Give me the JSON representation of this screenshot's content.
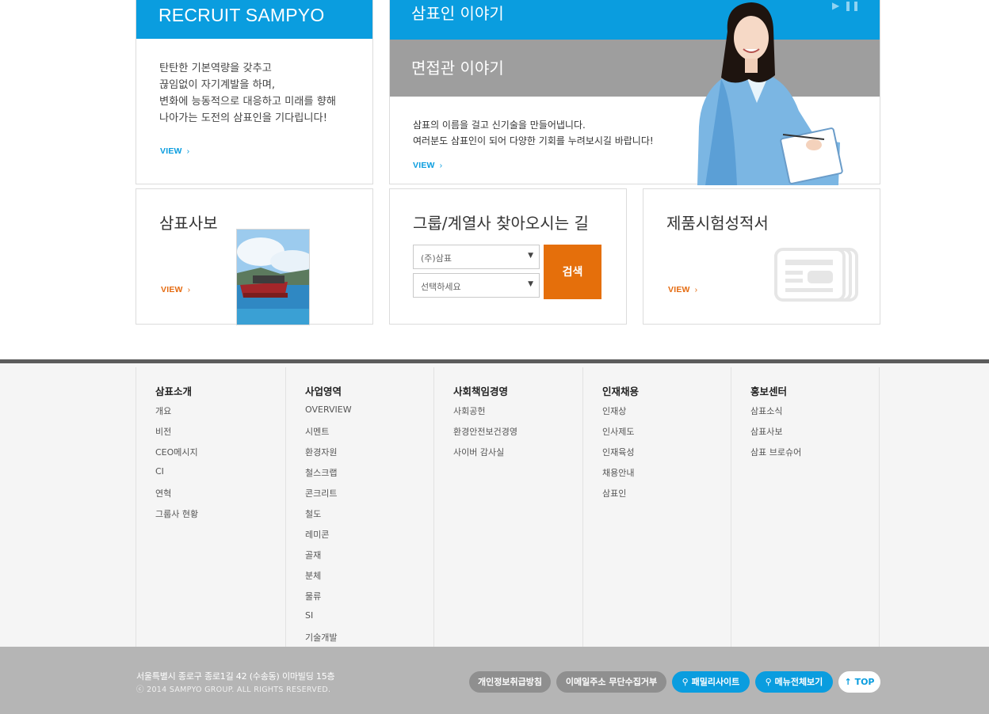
{
  "recruit": {
    "title": "RECRUIT SAMPYO",
    "lines": [
      "탄탄한 기본역량을 갖추고",
      "끊임없이 자기계발을 하며,",
      "변화에 능동적으로 대응하고 미래를 향해",
      "나아가는 도전의 삼표인을 기다립니다!"
    ],
    "view": "VIEW"
  },
  "story": {
    "title": "삼표인 이야기",
    "interview_title": "면접관 이야기",
    "lines": [
      "삼표의 이름을 걸고 신기술을 만들어냅니다.",
      "여러분도 삼표인이 되어 다양한 기회를 누려보시길 바랍니다!"
    ],
    "view": "VIEW",
    "play_icon": "play-icon",
    "pause_icon": "pause-icon"
  },
  "news": {
    "title": "삼표사보",
    "view": "VIEW"
  },
  "route": {
    "title": "그룹/계열사 찾아오시는 길",
    "company_select": "(주)삼표",
    "branch_select": "선택하세요",
    "search_label": "검색"
  },
  "cert": {
    "title": "제품시험성적서",
    "view": "VIEW",
    "icon": "document-icon"
  },
  "sitemap": [
    {
      "head": "삼표소개",
      "items": [
        "개요",
        "비전",
        "CEO메시지",
        "CI",
        "연혁",
        "그룹사 현황"
      ]
    },
    {
      "head": "사업영역",
      "items": [
        "OVERVIEW",
        "시멘트",
        "환경자원",
        "철스크랩",
        "콘크리트",
        "철도",
        "레미콘",
        "골재",
        "분체",
        "물류",
        "SI",
        "기술개발"
      ]
    },
    {
      "head": "사회책임경영",
      "items": [
        "사회공헌",
        "환경안전보건경영",
        "사이버 감사실"
      ]
    },
    {
      "head": "인재채용",
      "items": [
        "인재상",
        "인사제도",
        "인재육성",
        "채용안내",
        "삼표인"
      ]
    },
    {
      "head": "홍보센터",
      "items": [
        "삼표소식",
        "삼표사보",
        "삼표 브로슈어"
      ]
    }
  ],
  "footer": {
    "address": "서울특별시 종로구 종로1길 42 (수송동) 이마빌딩 15층",
    "copyright": "ⓒ 2014 SAMPYO GROUP. ALL RIGHTS RESERVED.",
    "privacy": "개인정보취급방침",
    "email_refuse": "이메일주소 무단수집거부",
    "family_site": "패밀리사이트",
    "all_menu": "메뉴전체보기",
    "top": "TOP"
  },
  "colors": {
    "accent_blue": "#0a9ddf",
    "accent_orange": "#e56f0b",
    "footer_gray": "#b5b5b5"
  }
}
